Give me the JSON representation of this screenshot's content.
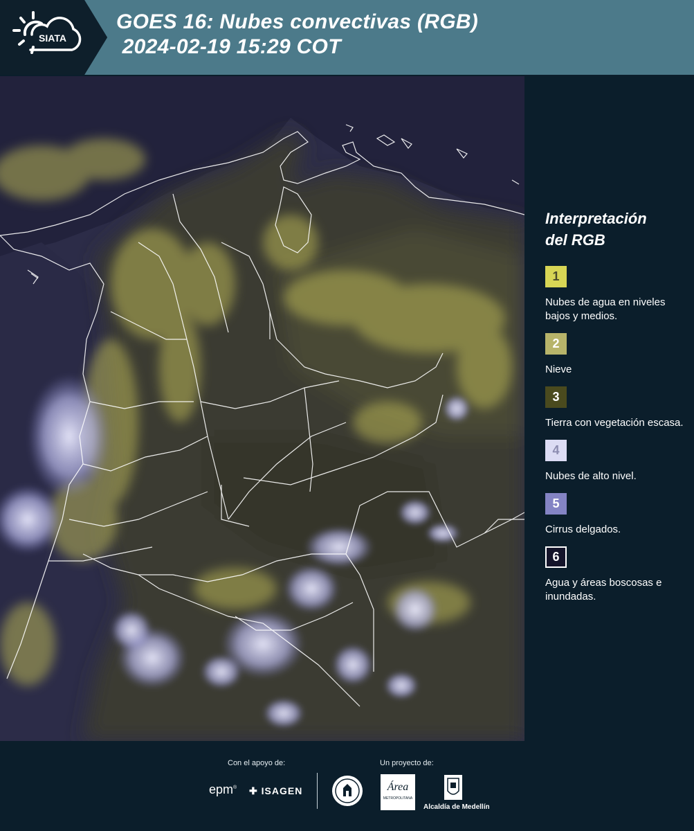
{
  "header": {
    "logo_text": "SIATA",
    "title_line1": "GOES 16: Nubes convectivas (RGB)",
    "title_line2": " 2024-02-19 15:29 COT"
  },
  "map": {
    "description_icon": "satellite-rgb-map"
  },
  "legend": {
    "title_line1": "Interpretación",
    "title_line2": "del RGB",
    "items": [
      {
        "number": "1",
        "label": "Nubes de agua en niveles bajos y medios.",
        "color": "#d8d655",
        "number_color": "#4a4a2a"
      },
      {
        "number": "2",
        "label": "Nieve",
        "color": "#b7b46a",
        "number_color": "#ffffff"
      },
      {
        "number": "3",
        "label": "Tierra con vegetación escasa.",
        "color": "#4a4a1e",
        "number_color": "#ffffff"
      },
      {
        "number": "4",
        "label": "Nubes de alto nivel.",
        "color": "#dcdcf4",
        "number_color": "#8c8cb0"
      },
      {
        "number": "5",
        "label": "Cirrus delgados.",
        "color": "#8484c4",
        "number_color": "#ffffff"
      },
      {
        "number": "6",
        "label": "Agua y áreas boscosas e inundadas.",
        "color": "#14142a",
        "number_color": "#ffffff"
      }
    ]
  },
  "footer": {
    "support_label": "Con el apoyo de:",
    "project_label": "Un proyecto de:",
    "sponsor_epm": "epm",
    "sponsor_isagen": "ISAGEN",
    "metropolitana_text": "Área",
    "metropolitana_sub": "METROPOLITANA",
    "alcaldia": "Alcaldía de Medellín"
  }
}
